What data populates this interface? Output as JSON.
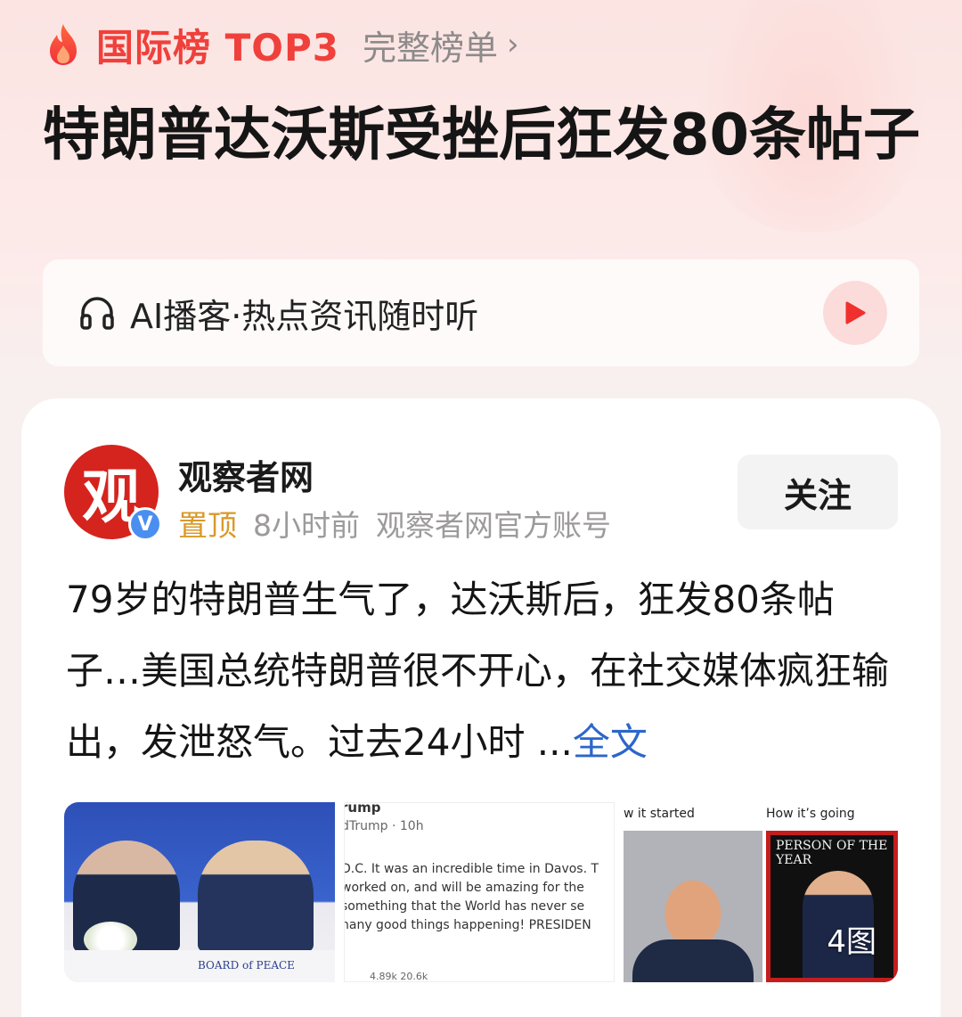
{
  "rank": {
    "label": "国际榜 TOP3",
    "full_list_label": "完整榜单",
    "chevron": "›",
    "icon": "flame-icon",
    "accent_color": "#f0403b"
  },
  "headline": "特朗普达沃斯受挫后狂发80条帖子",
  "podcast": {
    "text": "AI播客·热点资讯随时听",
    "icon": "headphones-icon",
    "play_icon": "play-icon"
  },
  "post": {
    "author": {
      "name": "观察者网",
      "avatar_glyph": "观",
      "verified_mark": "V"
    },
    "meta": {
      "pinned": "置顶",
      "time": "8小时前",
      "account_desc": "观察者网官方账号"
    },
    "follow_label": "关注",
    "text": "79岁的特朗普生气了，达沃斯后，狂发80条帖子…美国总统特朗普很不开心，在社交媒体疯狂输出，发泄怒气。过去24小时 ",
    "ellipsis": "...",
    "more_label": "全文",
    "images": {
      "image1_caption": "BOARD of PEACE",
      "image2_lines": [
        "rump",
        "dTrump · 10h",
        "D.C. It was an incredible time in Davos. T",
        "worked on, and will be amazing for the",
        "something that the World has never se",
        "nany good things happening! PRESIDEN",
        "4.89k      20.6k"
      ],
      "image3_left_caption": "w it started",
      "image3_right_caption": "How it’s going",
      "image3_time_title": "PERSON OF THE YEAR",
      "count": "4图"
    }
  }
}
